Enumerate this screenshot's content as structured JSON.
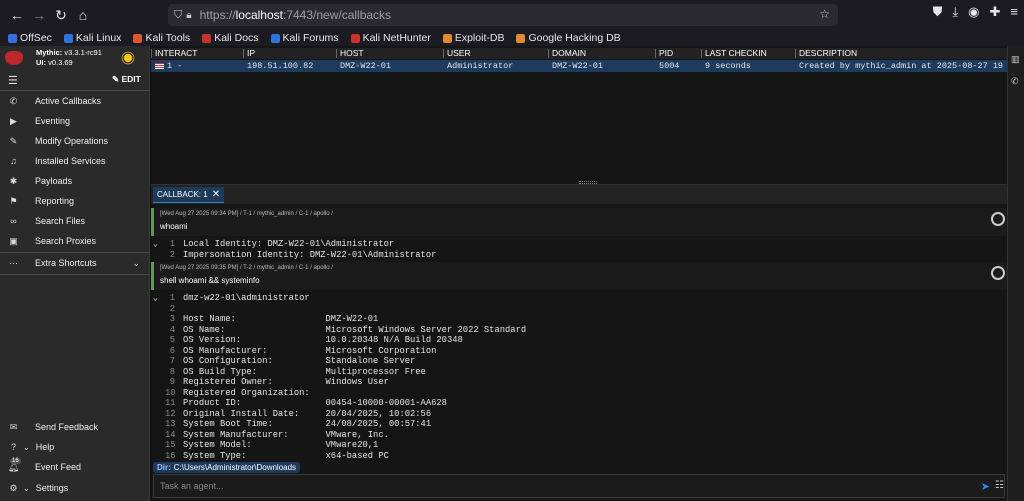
{
  "browser": {
    "url_prefix": "https://",
    "url_host": "localhost",
    "url_rest": ":7443/new/callbacks"
  },
  "bookmarks": [
    {
      "label": "OffSec",
      "color": "#3b6ee0"
    },
    {
      "label": "Kali Linux",
      "color": "#2d74da"
    },
    {
      "label": "Kali Tools",
      "color": "#e0562d"
    },
    {
      "label": "Kali Docs",
      "color": "#c8312c"
    },
    {
      "label": "Kali Forums",
      "color": "#2d74da"
    },
    {
      "label": "Kali NetHunter",
      "color": "#c8312c"
    },
    {
      "label": "Exploit-DB",
      "color": "#e08a2d"
    },
    {
      "label": "Google Hacking DB",
      "color": "#e08a2d"
    }
  ],
  "sidebar": {
    "mythic_label": "Mythic:",
    "mythic_version": "v3.3.1-rc91",
    "ui_label": "UI:",
    "ui_version": "v0.3.69",
    "edit_label": "EDIT",
    "items": [
      {
        "label": "Active Callbacks",
        "icon": "phone-icon"
      },
      {
        "label": "Eventing",
        "icon": "play-icon"
      },
      {
        "label": "Modify Operations",
        "icon": "pencil-icon"
      },
      {
        "label": "Installed Services",
        "icon": "headphones-icon"
      },
      {
        "label": "Payloads",
        "icon": "bug-icon"
      },
      {
        "label": "Reporting",
        "icon": "flag-icon"
      },
      {
        "label": "Search Files",
        "icon": "link-icon"
      },
      {
        "label": "Search Proxies",
        "icon": "proxy-icon"
      },
      {
        "label": "Extra Shortcuts",
        "icon": "dots-icon"
      }
    ],
    "bottom_items": [
      {
        "label": "Send Feedback",
        "icon": "feedback-icon"
      },
      {
        "label": "Help",
        "icon": "help-icon"
      },
      {
        "label": "Event Feed",
        "icon": "bell-icon",
        "badge": "16"
      },
      {
        "label": "Settings",
        "icon": "settings-icon"
      }
    ]
  },
  "callbacks_table": {
    "columns": [
      "INTERACT",
      "IP",
      "HOST",
      "USER",
      "DOMAIN",
      "PID",
      "LAST CHECKIN",
      "DESCRIPTION"
    ],
    "rows": [
      {
        "interact": "1 -",
        "ip": "198.51.100.82",
        "host": "DMZ-W22-01",
        "user": "Administrator",
        "domain": "DMZ-W22-01",
        "pid": "5004",
        "last_checkin": "9 seconds",
        "description": "Created by mythic_admin at 2025-08-27 19"
      }
    ]
  },
  "tab": {
    "label": "CALLBACK: 1"
  },
  "tasks": [
    {
      "meta": "[Wed Aug 27 2025 09:34 PM] / T-1 / mythic_admin / C-1 / apollo /",
      "command": "whoami",
      "output": [
        "Local Identity: DMZ-W22-01\\Administrator",
        "Impersonation Identity: DMZ-W22-01\\Administrator"
      ]
    },
    {
      "meta": "[Wed Aug 27 2025 09:35 PM] / T-2 / mythic_admin / C-1 / apollo /",
      "command": "shell whoami && systeminfo",
      "output": [
        "dmz-w22-01\\administrator",
        "",
        "Host Name:                 DMZ-W22-01",
        "OS Name:                   Microsoft Windows Server 2022 Standard",
        "OS Version:                10.0.20348 N/A Build 20348",
        "OS Manufacturer:           Microsoft Corporation",
        "OS Configuration:          Standalone Server",
        "OS Build Type:             Multiprocessor Free",
        "Registered Owner:          Windows User",
        "Registered Organization:",
        "Product ID:                00454-10000-00001-AA628",
        "Original Install Date:     20/04/2025, 10:02:56",
        "System Boot Time:          24/08/2025, 00:57:41",
        "System Manufacturer:       VMware, Inc.",
        "System Model:              VMware20,1",
        "System Type:               x64-based PC"
      ]
    }
  ],
  "dir": {
    "label": "Dir:",
    "path": "C:\\Users\\Administrator\\Downloads"
  },
  "task_input": {
    "placeholder": "Task an agent..."
  }
}
